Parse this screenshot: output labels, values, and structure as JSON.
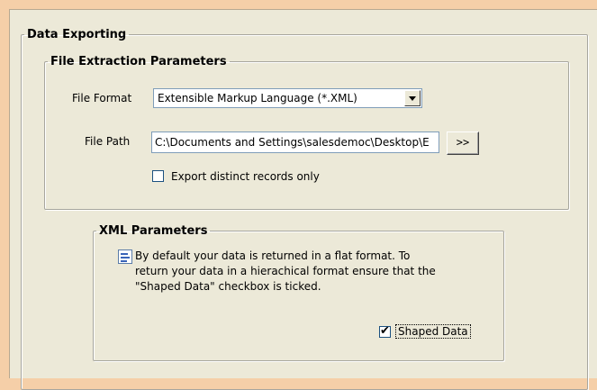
{
  "data_exporting": {
    "title": "Data Exporting",
    "file_extraction": {
      "title": "File Extraction Parameters",
      "file_format_label": "File Format",
      "file_format_value": "Extensible Markup Language (*.XML)",
      "file_path_label": "File Path",
      "file_path_value": "C:\\Documents and Settings\\salesdemoc\\Desktop\\E",
      "browse_label": ">>",
      "distinct_label": "Export distinct records only",
      "distinct_checked": false
    },
    "xml_parameters": {
      "title": "XML Parameters",
      "info_text_line1": "By default your data is returned in a flat format. To",
      "info_text_line2": "return your data in a hierachical format ensure that the",
      "info_text_line3": "\"Shaped Data\" checkbox is ticked.",
      "shaped_label": "Shaped Data",
      "shaped_checked": true,
      "shaped_check_glyph": "✔"
    }
  }
}
